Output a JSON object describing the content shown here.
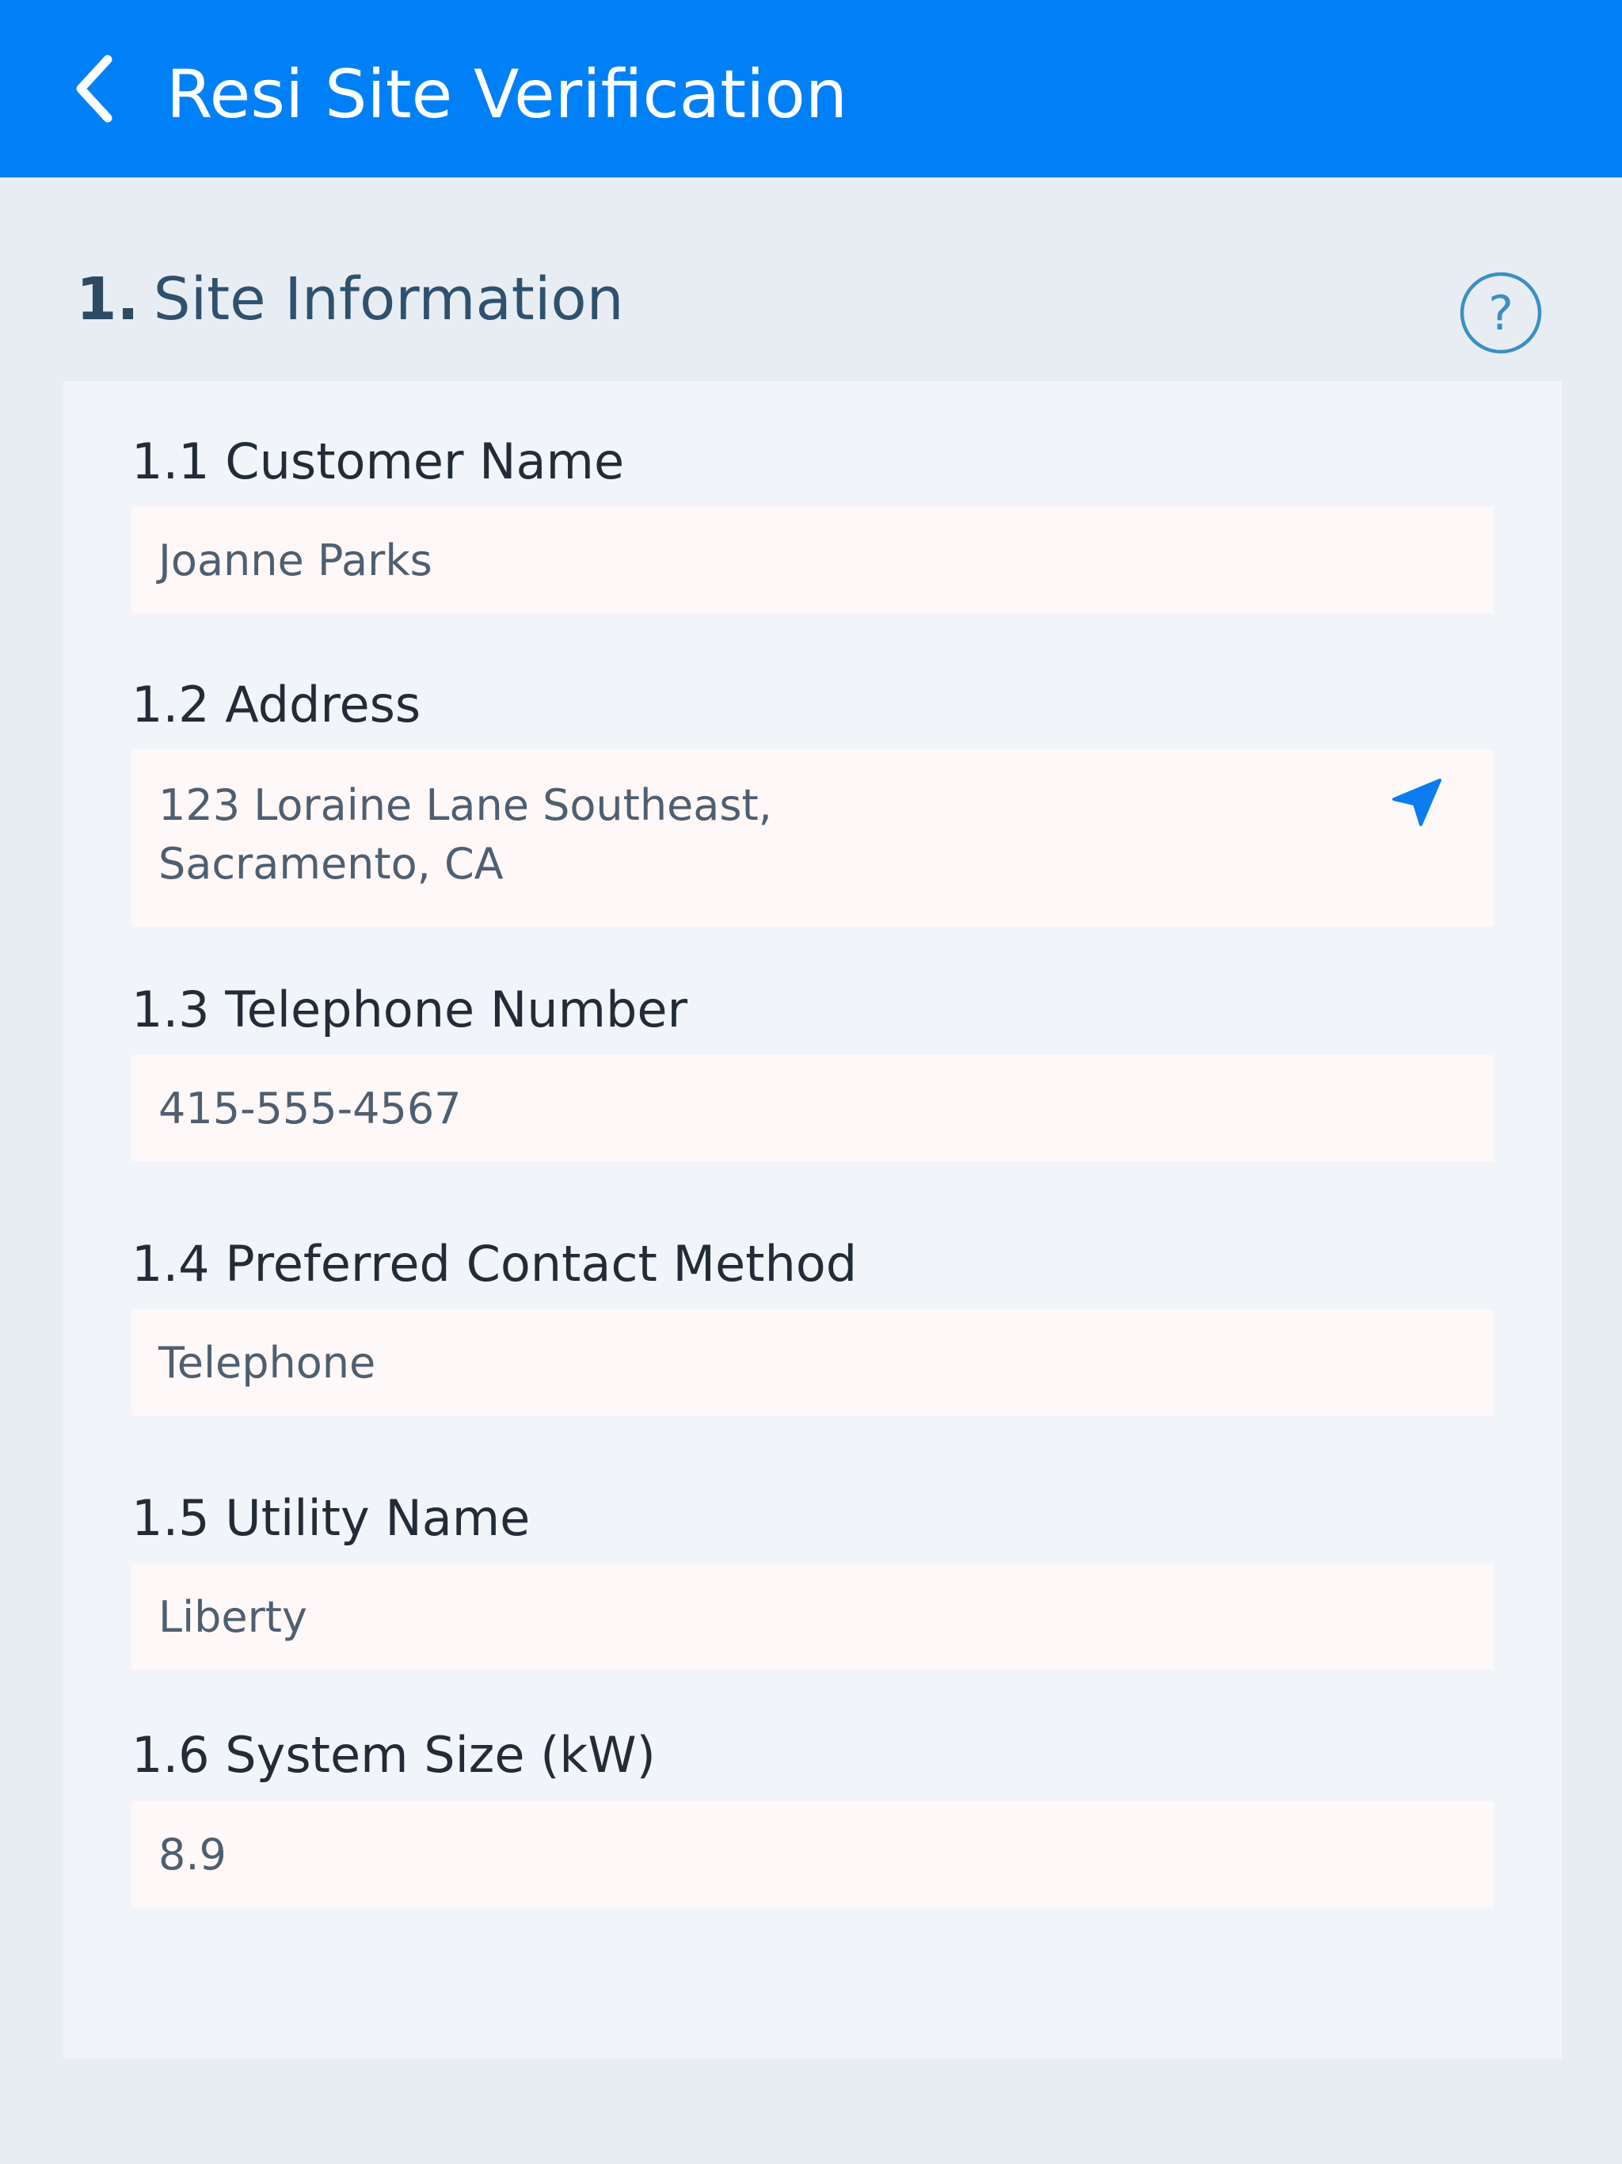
{
  "header": {
    "title": "Resi Site Verification",
    "back_icon": "chevron-left-icon",
    "background_color": "#0080f6"
  },
  "section": {
    "number": "1.",
    "title": "Site Information",
    "help_icon": "help-circle-icon",
    "help_glyph": "?"
  },
  "fields": {
    "customer_name": {
      "label": "1.1 Customer Name",
      "value": "Joanne Parks"
    },
    "address": {
      "label": "1.2 Address",
      "line1": "123 Loraine Lane Southeast,",
      "line2": "Sacramento, CA",
      "action_icon": "location-arrow-icon"
    },
    "telephone": {
      "label": "1.3 Telephone Number",
      "value": "415-555-4567"
    },
    "contact_method": {
      "label": "1.4 Preferred Contact Method",
      "value": "Telephone"
    },
    "utility_name": {
      "label": "1.5 Utility Name",
      "value": "Liberty"
    },
    "system_size": {
      "label": "1.6 System Size (kW)",
      "value": "8.9"
    }
  },
  "colors": {
    "accent": "#0080f6",
    "page_background": "#e8edf4",
    "card_background": "#f1f5f9",
    "input_background": "#fff8f8",
    "section_title": "#2f516d",
    "help_icon": "#3a8fc4"
  }
}
